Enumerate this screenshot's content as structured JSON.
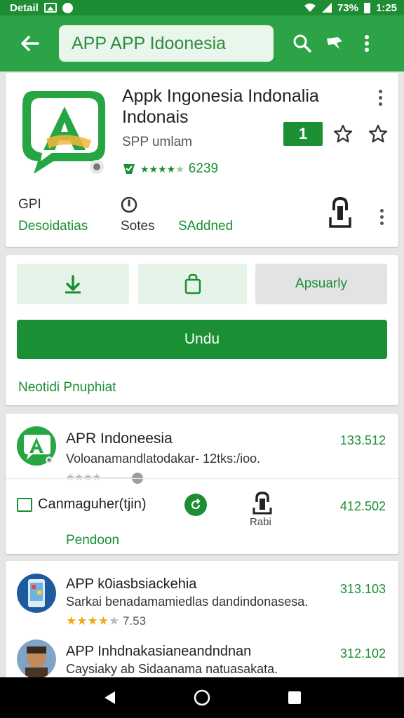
{
  "status_bar": {
    "title": "Detail",
    "battery_percent": "73%",
    "time": "1:25"
  },
  "toolbar": {
    "search_value": "APP  APP Idoonesia"
  },
  "app": {
    "title_line1": "Appk  Ingonesia Indonalia",
    "title_line2": "Indonais",
    "developer": "SPP umlam",
    "rank_badge": "1",
    "rating_count": "6239",
    "meta": [
      {
        "top": "GPI",
        "bottom": "Desoidatias"
      },
      {
        "top": "",
        "bottom": "Sotes"
      },
      {
        "top": "",
        "bottom": "SAddned"
      }
    ]
  },
  "actions": {
    "third_label": "Apsuarly",
    "install_label": "Undu",
    "link_label": "Neotidi Pnuphiat"
  },
  "related": {
    "title": "APR Indoneesia",
    "description": "Voloanamandlatodakar- 12tks:/ioo.",
    "price1": "133.512",
    "row2_label": "Canmaguher(tjin)",
    "row2_sub": "Rabi",
    "price2": "412.502",
    "link": "Pendoon"
  },
  "more_apps": [
    {
      "title": "APP k0iasbsiackehia",
      "description": "Sarkai benadamamiedlas dandindonasesa.",
      "rating": "7.53",
      "price": "313.103"
    },
    {
      "title": "APP Inhdnakasianeandndnan",
      "description": "Caysiaky ab Sidaanama natuasakata.",
      "price": "312.102"
    }
  ],
  "colors": {
    "status_green": "#1e8c32",
    "toolbar_green": "#2ca347",
    "accent_green": "#1a8f33",
    "star_gold": "#f2a516"
  }
}
